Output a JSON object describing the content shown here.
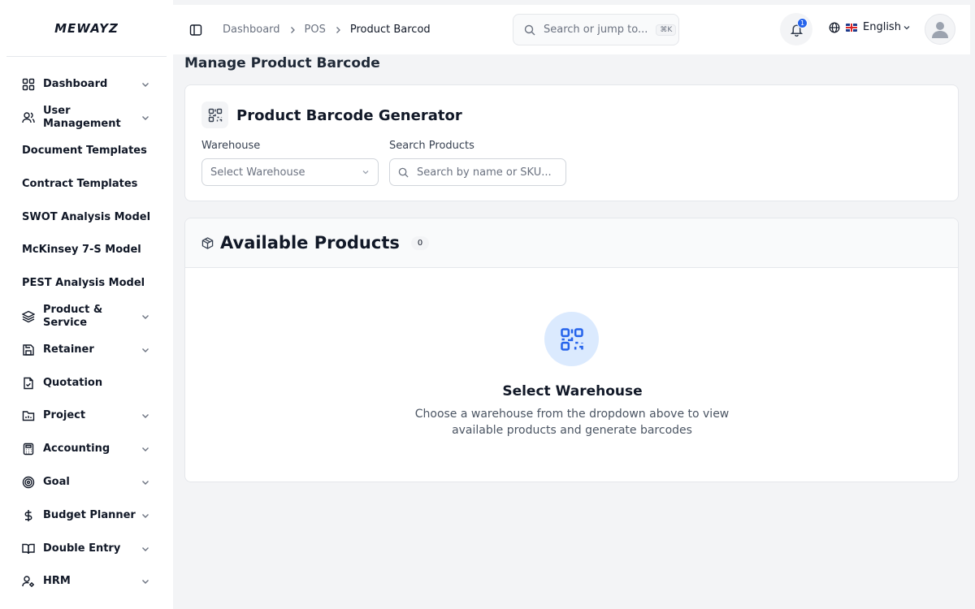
{
  "app": {
    "logo": "MEWAYZ"
  },
  "sidebar": {
    "items": [
      {
        "label": "Dashboard",
        "icon": "grid-icon",
        "chevron": true
      },
      {
        "label": "User Management",
        "icon": "users-icon",
        "chevron": true
      },
      {
        "label": "Document Templates",
        "icon": "",
        "chevron": false
      },
      {
        "label": "Contract Templates",
        "icon": "",
        "chevron": false
      },
      {
        "label": "SWOT Analysis Model",
        "icon": "",
        "chevron": false
      },
      {
        "label": "McKinsey 7-S Model",
        "icon": "",
        "chevron": false
      },
      {
        "label": "PEST Analysis Model",
        "icon": "",
        "chevron": false
      },
      {
        "label": "Product & Service",
        "icon": "layers-icon",
        "chevron": true
      },
      {
        "label": "Retainer",
        "icon": "save-icon",
        "chevron": true
      },
      {
        "label": "Quotation",
        "icon": "file-check-icon",
        "chevron": false
      },
      {
        "label": "Project",
        "icon": "folder-chart-icon",
        "chevron": true
      },
      {
        "label": "Accounting",
        "icon": "calculator-icon",
        "chevron": true
      },
      {
        "label": "Goal",
        "icon": "target-icon",
        "chevron": true
      },
      {
        "label": "Budget Planner",
        "icon": "dollar-icon",
        "chevron": true
      },
      {
        "label": "Double Entry",
        "icon": "book-open-icon",
        "chevron": true
      },
      {
        "label": "HRM",
        "icon": "user-cog-icon",
        "chevron": true
      }
    ]
  },
  "topbar": {
    "breadcrumb": [
      "Dashboard",
      "POS",
      "Product Barcod"
    ],
    "search_placeholder": "Search or jump to...",
    "search_shortcut": "⌘K",
    "notification_count": "1",
    "language": "English"
  },
  "main": {
    "page_title": "Manage Product Barcode",
    "generator": {
      "title": "Product Barcode Generator",
      "warehouse_label": "Warehouse",
      "warehouse_placeholder": "Select Warehouse",
      "search_label": "Search Products",
      "search_placeholder": "Search by name or SKU..."
    },
    "products": {
      "title": "Available Products",
      "count": "0",
      "empty_title": "Select Warehouse",
      "empty_desc": "Choose a warehouse from the dropdown above to view available products and generate barcodes"
    }
  },
  "colors": {
    "accent": "#2563eb",
    "empty_icon_bg": "#dbeafe"
  }
}
